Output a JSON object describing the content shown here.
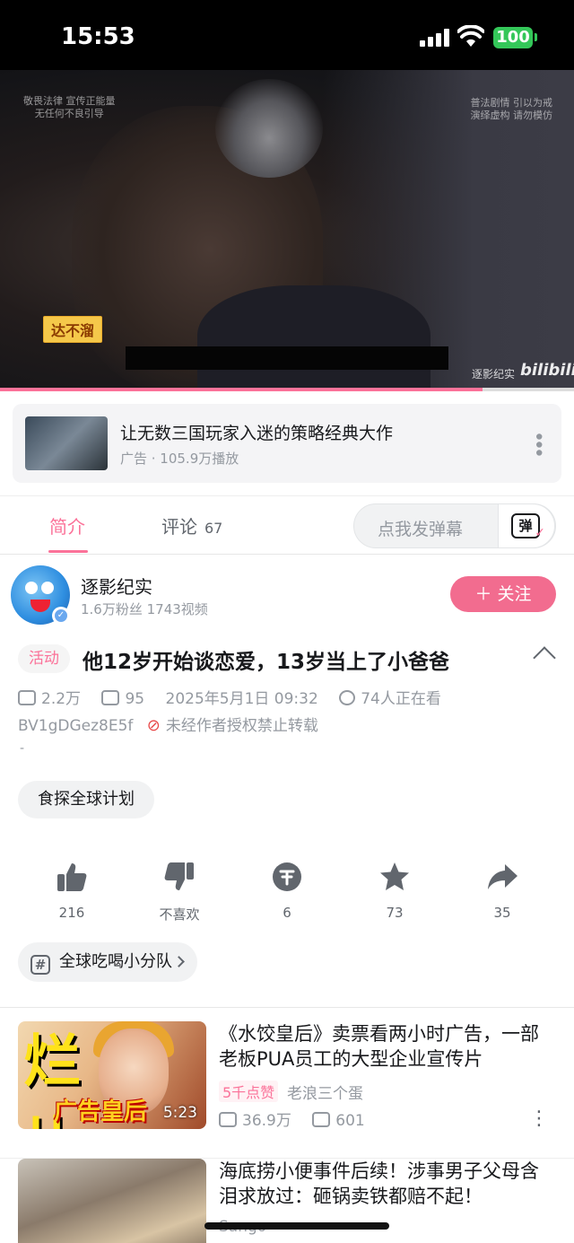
{
  "status_bar": {
    "time": "15:53",
    "battery": "100"
  },
  "player": {
    "watermark_left": [
      "敬畏法律 宣传正能量",
      "无任何不良引导"
    ],
    "watermark_right": [
      "普法剧情 引以为戒",
      "演绎虚构 请勿模仿"
    ],
    "subtitle_tag": "达不溜",
    "channel_mark": "逐影纪实",
    "logo": "bilibili",
    "progress": 0.84
  },
  "ad": {
    "title": "让无数三国玩家入迷的策略经典大作",
    "meta": "广告 · 105.9万播放"
  },
  "tabs": {
    "intro": "简介",
    "comments": "评论",
    "comments_count": "67",
    "danmaku_placeholder": "点我发弹幕",
    "danmaku_button": "弹"
  },
  "author": {
    "name": "逐影纪实",
    "stats": "1.6万粉丝  1743视频",
    "follow_label": "＋ 关注"
  },
  "video": {
    "activity_tag": "活动",
    "title": "他12岁开始谈恋爱，13岁当上了小爸爸",
    "plays": "2.2万",
    "danmaku_count": "95",
    "date": "2025年5月1日 09:32",
    "watching": "74人正在看",
    "bvid": "BV1gDGez8E5f",
    "copyright": "未经作者授权禁止转载",
    "desc": "-",
    "tag": "食探全球计划"
  },
  "actions": {
    "like": "216",
    "dislike": "不喜欢",
    "coin": "6",
    "favorite": "73",
    "share": "35"
  },
  "topic": {
    "label": "全球吃喝小分队"
  },
  "recommendations": [
    {
      "title": "《水饺皇后》卖票看两小时广告，一部老板PUA员工的大型企业宣传片",
      "thumb_big": "烂片",
      "thumb_banner": "广告皇后",
      "duration": "5:23",
      "hot": "5千点赞",
      "uploader": "老浪三个蛋",
      "views": "36.9万",
      "comments": "601"
    },
    {
      "title": "海底捞小便事件后续！涉事男子父母含泪求放过：砸锅卖铁都赔不起！",
      "uploader": "Sango"
    }
  ]
}
